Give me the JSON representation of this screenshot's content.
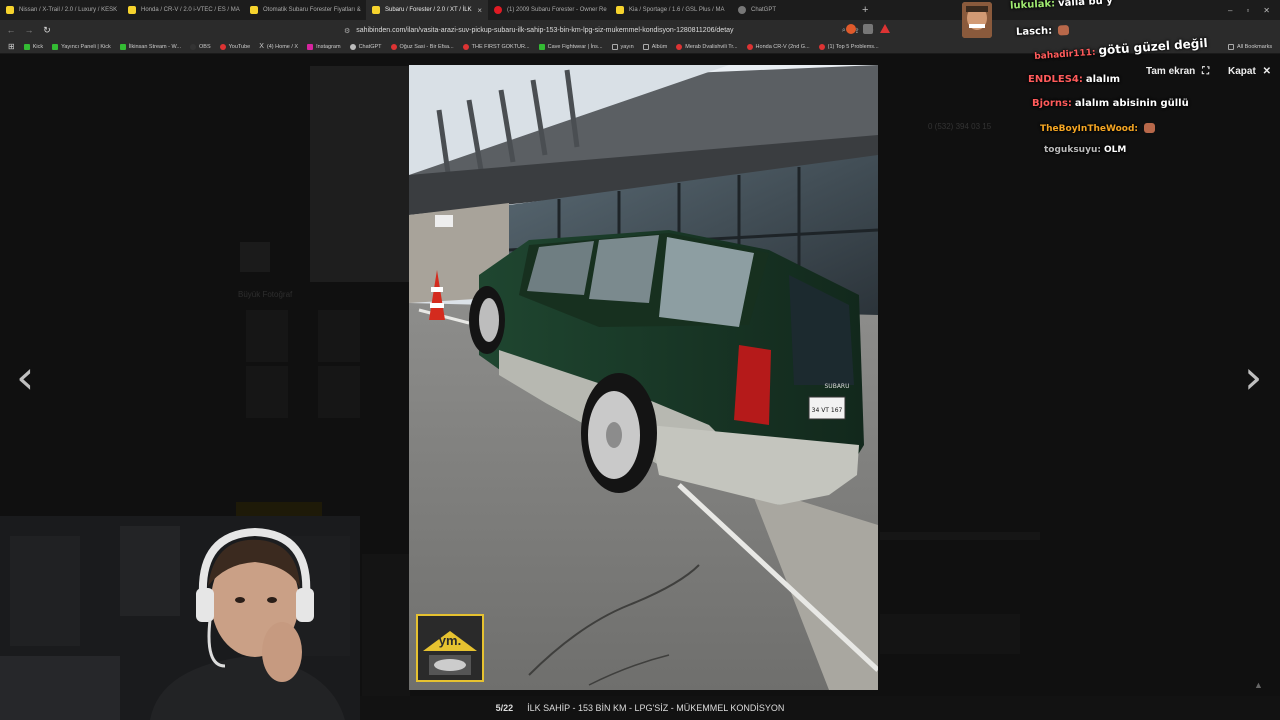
{
  "tabs": [
    {
      "title": "Nissan / X-Trail / 2.0 / Luxury / KESK",
      "icon": "sahibinden-icon",
      "active": false
    },
    {
      "title": "Honda / CR-V / 2.0 i-VTEC / ES / MA",
      "icon": "sahibinden-icon",
      "active": false
    },
    {
      "title": "Otomatik Subaru Forester Fiyatları & ",
      "icon": "sahibinden-icon",
      "active": false
    },
    {
      "title": "Subaru / Forester / 2.0 / XT / İLK",
      "icon": "sahibinden-icon",
      "active": true
    },
    {
      "title": "(1) 2009 Subaru Forester - Owner Re",
      "icon": "youtube-icon",
      "active": false
    },
    {
      "title": "Kia / Sportage / 1.6 / GSL Plus / MA",
      "icon": "sahibinden-icon",
      "active": false
    },
    {
      "title": "ChatGPT",
      "icon": "chatgpt-icon",
      "active": false
    }
  ],
  "tab_close": "×",
  "new_tab": "+",
  "window_controls": {
    "minimize": "–",
    "maximize": "▫",
    "close": "✕"
  },
  "nav": {
    "back": "←",
    "forward": "→",
    "reload": "↻",
    "apps": "⊞"
  },
  "address": {
    "url": "sahibinden.com/ilan/vasita-arazi-suv-pickup-subaru-ilk-sahip-153-bin-km-lpg-siz-mukemmel-kondisyon-1280811206/detay"
  },
  "bookmarks": [
    {
      "label": "Kick",
      "icon": "kick-icon"
    },
    {
      "label": "Yayıncı Paneli | Kick",
      "icon": "kick-icon"
    },
    {
      "label": "İlkinsan Stream - W...",
      "icon": "kick-icon"
    },
    {
      "label": "OBS",
      "icon": "obs-icon"
    },
    {
      "label": "YouTube",
      "icon": "youtube-icon"
    },
    {
      "label": "(4) Home / X",
      "icon": "x-icon"
    },
    {
      "label": "Instagram",
      "icon": "instagram-icon"
    },
    {
      "label": "ChatGPT",
      "icon": "chatgpt-icon"
    },
    {
      "label": "Oğuz Sasi - Bir Efsa...",
      "icon": "youtube-icon"
    },
    {
      "label": "THE FIRST GOKTUR...",
      "icon": "youtube-icon"
    },
    {
      "label": "Cave Fightwear | İns...",
      "icon": "cave-icon"
    },
    {
      "label": "yayın",
      "icon": "folder-icon"
    },
    {
      "label": "Albüm",
      "icon": "folder-icon"
    },
    {
      "label": "Merab Dvalishvili Tr...",
      "icon": "youtube-icon"
    },
    {
      "label": "Honda CR-V (2nd G...",
      "icon": "youtube-icon"
    },
    {
      "label": "(1) Top 5 Problems...",
      "icon": "youtube-icon"
    }
  ],
  "all_bookmarks": "All Bookmarks",
  "background_page": {
    "phone": "0 (532) 394 03 15",
    "gallery_label": "Büyük Fotoğraf"
  },
  "viewer": {
    "fullscreen_label": "Tam ekran",
    "close_label": "Kapat",
    "prev": "‹",
    "next": "›",
    "counter": "5/22",
    "caption": "İLK SAHİP - 153 BİN KM - LPG'SİZ - MÜKEMMEL KONDİSYON",
    "plate_text": "34 VT 167",
    "brand_text": "SUBARU",
    "logo_text": "ym."
  },
  "chat": [
    {
      "user": "lukulak:",
      "message": "valla bu y",
      "color": "#9fe870"
    },
    {
      "user": "Lasch:",
      "message": "",
      "color": "#ffffff",
      "emote": "emote"
    },
    {
      "user": "bahadir111:",
      "message": "götü güzel değil",
      "color": "#ff5b5b"
    },
    {
      "user": "ENDLES4:",
      "message": "alalım",
      "color": "#ff5b5b"
    },
    {
      "user": "Bjorns:",
      "message": "alalım abisinin güllü",
      "color": "#ff5b5b"
    },
    {
      "user": "TheBoyInTheWood:",
      "message": "",
      "color": "#f5a623",
      "emote": "emote"
    },
    {
      "user": "toguksuyu:",
      "message": "OLM",
      "color": "#bbbbbb"
    }
  ],
  "colors": {
    "accent_green": "#2a7f3a",
    "car_green": "#1d3d2a",
    "chat_red": "#ff5b5b"
  }
}
